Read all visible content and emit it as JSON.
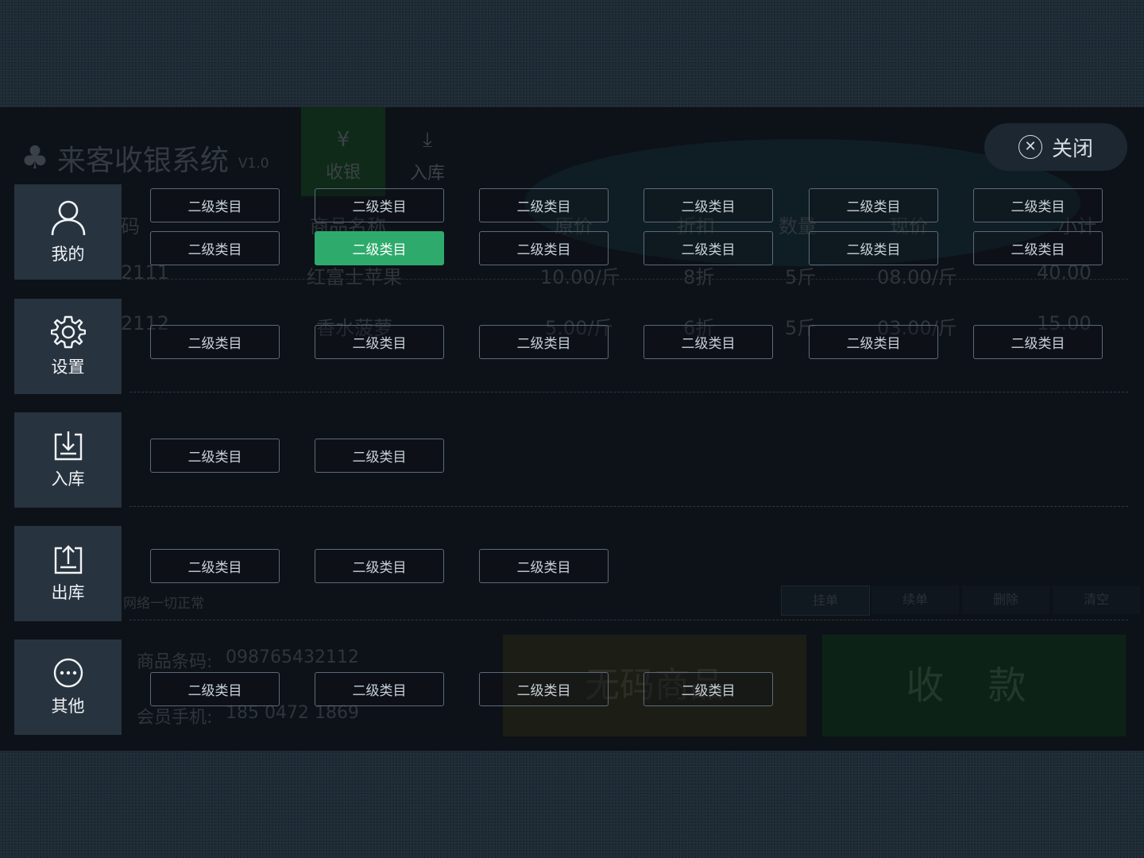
{
  "app": {
    "title": "来客收银系统",
    "version": "V1.0",
    "logo_icon": "clover-icon"
  },
  "top_tabs": [
    {
      "label": "收银",
      "icon": "yen-icon",
      "active": true
    },
    {
      "label": "入库",
      "icon": "download-icon",
      "active": false
    }
  ],
  "close_button": {
    "label": "关闭",
    "icon": "close-circle-icon"
  },
  "side_menu": [
    {
      "label": "我的",
      "icon": "user-icon"
    },
    {
      "label": "设置",
      "icon": "gear-icon"
    },
    {
      "label": "入库",
      "icon": "import-icon"
    },
    {
      "label": "出库",
      "icon": "export-icon"
    },
    {
      "label": "其他",
      "icon": "more-icon"
    }
  ],
  "subcategory_groups": [
    {
      "items": [
        "二级类目",
        "二级类目",
        "二级类目",
        "二级类目",
        "二级类目",
        "二级类目",
        "二级类目",
        "二级类目",
        "二级类目",
        "二级类目",
        "二级类目",
        "二级类目",
        "二级类目",
        "二级类目",
        "二级类目",
        "二级类目",
        "二级类目",
        "二级类目"
      ],
      "active_index": 7
    },
    {
      "items": [
        "二级类目",
        "二级类目"
      ]
    },
    {
      "items": [
        "二级类目",
        "二级类目",
        "二级类目"
      ]
    },
    {
      "items": [
        "二级类目",
        "二级类目",
        "二级类目",
        "二级类目"
      ]
    }
  ],
  "background": {
    "table_headers": [
      "码",
      "商品名称",
      "原价",
      "折扣",
      "数量",
      "现价",
      "小计"
    ],
    "rows": [
      {
        "code": "2111",
        "name": "红富士苹果",
        "price": "10.00/斤",
        "discount": "8折",
        "qty": "5斤",
        "now": "08.00/斤",
        "subtotal": "40.00"
      },
      {
        "code": "2112",
        "name": "香水菠萝",
        "price": "5.00/斤",
        "discount": "6折",
        "qty": "5斤",
        "now": "03.00/斤",
        "subtotal": "15.00"
      }
    ],
    "network_status": "网络一切正常",
    "actions": [
      "挂单",
      "续单",
      "删除",
      "清空"
    ],
    "barcode_label": "商品条码:",
    "barcode_value": "098765432112",
    "member_label": "会员手机:",
    "member_value": "185 0472 1869",
    "no_code_button": "无码商品",
    "pay_button": "收 款"
  },
  "colors": {
    "active_green": "#2eaa6c",
    "sidebar_bg": "#27333f",
    "outline": "#5d6a79"
  }
}
